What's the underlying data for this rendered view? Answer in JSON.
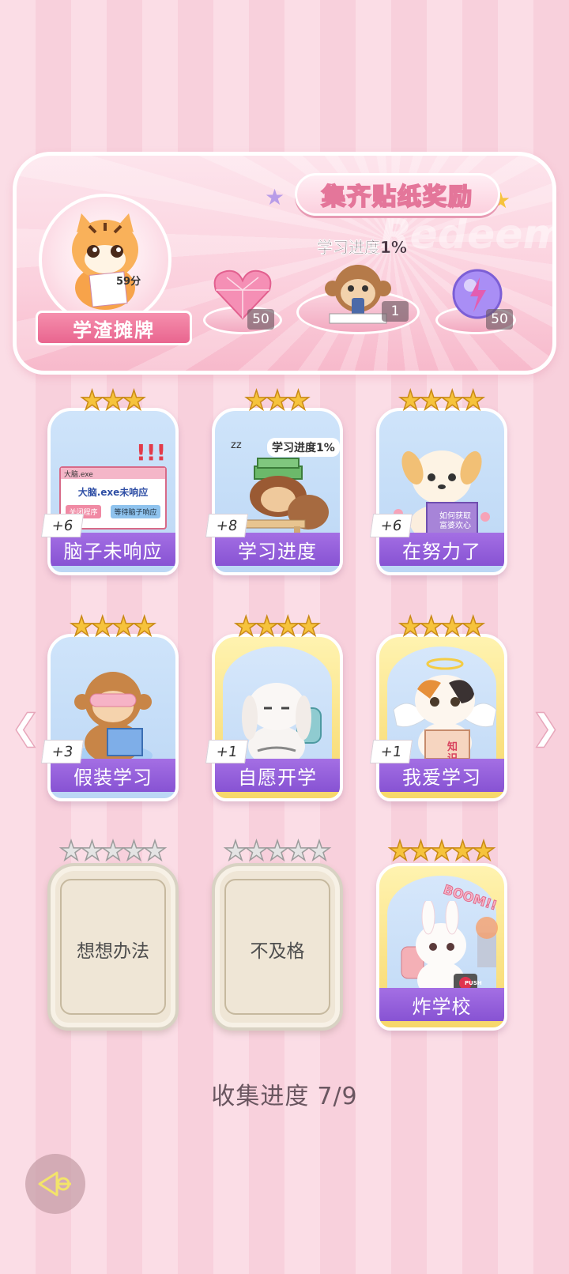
{
  "banner": {
    "title": "集齐贴纸奖励",
    "watermark": "Redeem",
    "ribbon_label": "学渣摊牌",
    "tiger_paper": "59分",
    "progress_caption": "学习进度1%",
    "rewards": [
      {
        "icon": "pink-heart-diamond-icon",
        "count": "50"
      },
      {
        "icon": "monkey-phone-sticker-icon",
        "count": "1"
      },
      {
        "icon": "purple-lightning-orb-icon",
        "count": "50"
      }
    ]
  },
  "stickers": [
    {
      "label": "脑子未响应",
      "bonus": "+6",
      "stars": 3,
      "state": "collected",
      "art": {
        "title": "大脑.exe",
        "msg": "大脑.exe未响应",
        "btn1": "关闭程序",
        "btn2": "等待脑子响应"
      }
    },
    {
      "label": "学习进度",
      "bonus": "+8",
      "stars": 3,
      "state": "collected",
      "art": {
        "caption": "学习进度1%"
      }
    },
    {
      "label": "在努力了",
      "bonus": "+6",
      "stars": 4,
      "state": "collected",
      "art": {
        "book": "如何获取富婆欢心"
      }
    },
    {
      "label": "假装学习",
      "bonus": "+3",
      "stars": 4,
      "state": "collected"
    },
    {
      "label": "自愿开学",
      "bonus": "+1",
      "stars": 4,
      "state": "collected-gold"
    },
    {
      "label": "我爱学习",
      "bonus": "+1",
      "stars": 4,
      "state": "collected-gold",
      "art": {
        "book": "知识"
      }
    },
    {
      "label": "想想办法",
      "stars": 5,
      "state": "locked"
    },
    {
      "label": "不及格",
      "stars": 5,
      "state": "locked"
    },
    {
      "label": "炸学校",
      "stars": 5,
      "state": "collected-gold",
      "art": {
        "boom": "BOOM!!",
        "push": "PUSH"
      }
    }
  ],
  "footer": {
    "label": "收集进度",
    "value": "7/9"
  }
}
